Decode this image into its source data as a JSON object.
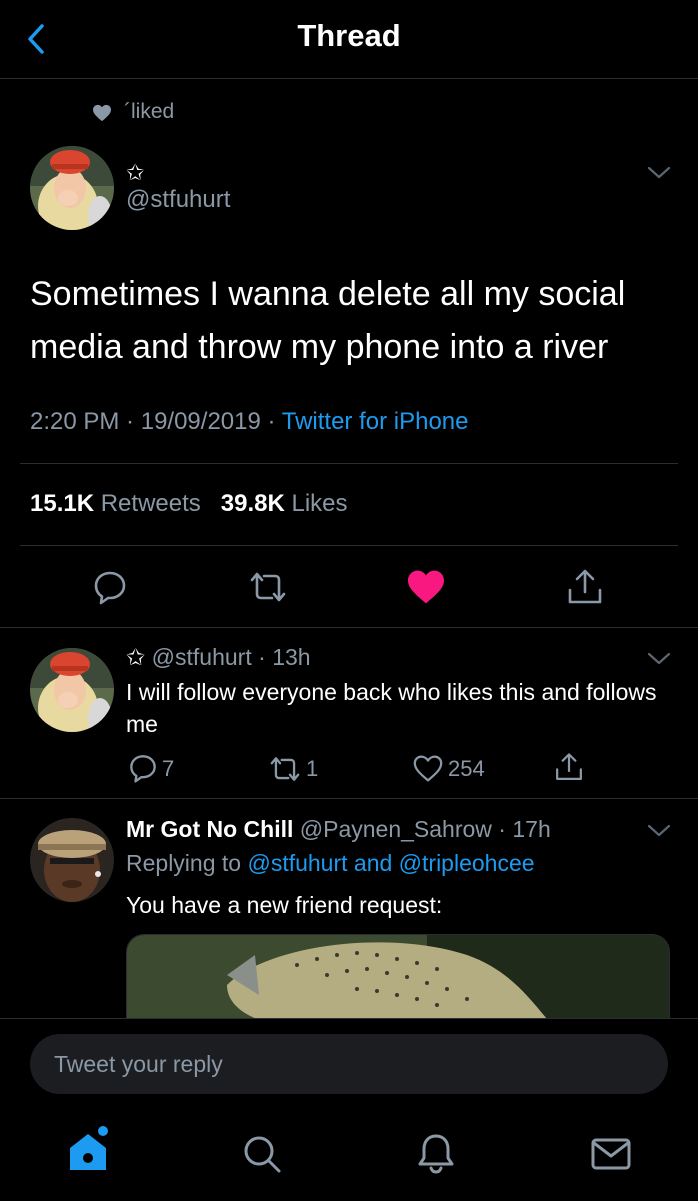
{
  "header": {
    "title": "Thread",
    "back_icon": "chevron-left-icon"
  },
  "social_context": {
    "icon": "heart-icon",
    "text": "´liked"
  },
  "main_tweet": {
    "name_symbol": "✩",
    "handle": "@stfuhurt",
    "text": "Sometimes I wanna delete all my social media and throw my phone into a river",
    "time": "2:20 PM",
    "date": "19/09/2019",
    "source": "Twitter for iPhone",
    "retweets_count": "15.1K",
    "retweets_label": "Retweets",
    "likes_count": "39.8K",
    "likes_label": "Likes",
    "actions": [
      "reply-icon",
      "retweet-icon",
      "heart-filled-icon",
      "share-icon"
    ]
  },
  "replies": [
    {
      "name_symbol": "✩",
      "handle": "@stfuhurt",
      "time": "13h",
      "text": "I will follow everyone back who likes this and follows me",
      "reply_count": "7",
      "retweet_count": "1",
      "like_count": "254"
    },
    {
      "name": "Mr Got No Chill",
      "handle": "@Paynen_Sahrow",
      "time": "17h",
      "replying_prefix": "Replying to",
      "replying_to": "@stfuhurt and @tripleohcee",
      "text": "You have a new friend request:"
    }
  ],
  "reply_bar": {
    "placeholder": "Tweet your reply"
  },
  "tab_bar": [
    "home-icon",
    "search-icon",
    "notifications-icon",
    "messages-icon"
  ],
  "colors": {
    "accent": "#1d9bf0",
    "like": "#f91880",
    "secondary_text": "#8b98a5",
    "background": "#000000"
  }
}
